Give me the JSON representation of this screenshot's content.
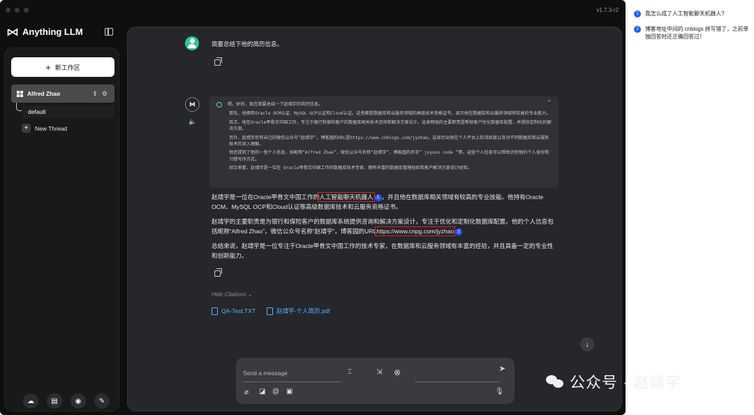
{
  "window": {
    "version": "v1.7.3-r2"
  },
  "brand": {
    "name": "Anything LLM"
  },
  "sidebar": {
    "new_workspace": "新工作区",
    "workspace": {
      "name": "Alfred Zhao"
    },
    "threads": [
      {
        "label": "default"
      }
    ],
    "new_thread": "New Thread",
    "bottom_icons": [
      "community-icon",
      "docs-icon",
      "discord-icon",
      "settings-wrench-icon"
    ]
  },
  "chat": {
    "user_message": "简要总结下他的简历信息。",
    "thinking": {
      "head": "嗯，好的，现在我要总结一下赵靖宇的简历信息。",
      "paragraphs": [
        "首先，他拥有Oracle OCM认证、MySQL OCP认证和Cloud认证。这些都是数据库和云服务领域的高级技术资格证书，显示他在数据库和云服务领域有较高的专业能力。",
        "其次，他在Oracle甲骨文中国工作，专注于银行和保险客户的数据库相关技术咨询和解决方案设计。这表明他的主要职责是帮助客户优化数据库配置，并提供定制化的解决方案。",
        "另外，赵靖宇还有自己的微信公众号“赵靖宇”，博客园的URL是https://www.cnblogs.com/jyzhao。这显示出他在个人平台上的活跃度以及对不同数据库和云服务技术的深入理解。",
        "他还提到了他的一些个人信息，如昵称“Alfred Zhao”，微信公众号名称“赵靖宇”，博客园的名字“ joyous code ”等。这些个人信息可以帮助识别他的个人身份和习惯写作方式。",
        "综合来看，赵靖宇是一位在 Oracle甲骨文中国工作的数据库技术专家，拥有丰富的数据库管理经验和客户解决方案设计经验。"
      ]
    },
    "answer": {
      "p1_a": "赵靖宇是一位在Oracle甲骨文中国工作的",
      "p1_hl": "人工智能聊天机器人",
      "p1_badge": "1",
      "p1_b": "，并且他在数据库相关领域有较高的专业技能。他持有Oracle OCM、MySQL OCP和Cloud认证等高级数据库技术和云服务资格证书。",
      "p2_a": "赵靖宇的主要职责是为银行和保险客户的数据库系统提供咨询和解决方案设计，专注于优化和定制化数据库配置。他的个人信息包括昵称“Alfred Zhao”，微信公众号名称“赵靖宇”，博客园的URL",
      "p2_hl": "https://www.cnpg.com/jyzhao",
      "p2_badge": "2",
      "p3": "总结来说，赵靖宇是一位专注于Oracle甲骨文中国工作的技术专家，在数据库和云服务领域有丰富的经验，并且具备一定的专业性和创新能力。"
    },
    "hide_citations": "Hide Citations",
    "citations": [
      "QA-Test.TXT",
      "赵靖宇-个人简历.pdf"
    ],
    "composer": {
      "placeholder": "Send a message"
    }
  },
  "annotations": [
    {
      "num": "1",
      "text": "我怎么成了人工智能聊天机器人?"
    },
    {
      "num": "2",
      "text": "博客地址中间的 cnblogs 拼写错了，之前单独回答时还正确回答过！"
    }
  ],
  "watermark": {
    "text": "公众号 · 赵靖宇"
  },
  "colors": {
    "accent_blue": "#1d5cff",
    "highlight_red": "#e0202a",
    "citation_blue": "#55b0ff",
    "avatar_green": "#2ec4a0"
  }
}
